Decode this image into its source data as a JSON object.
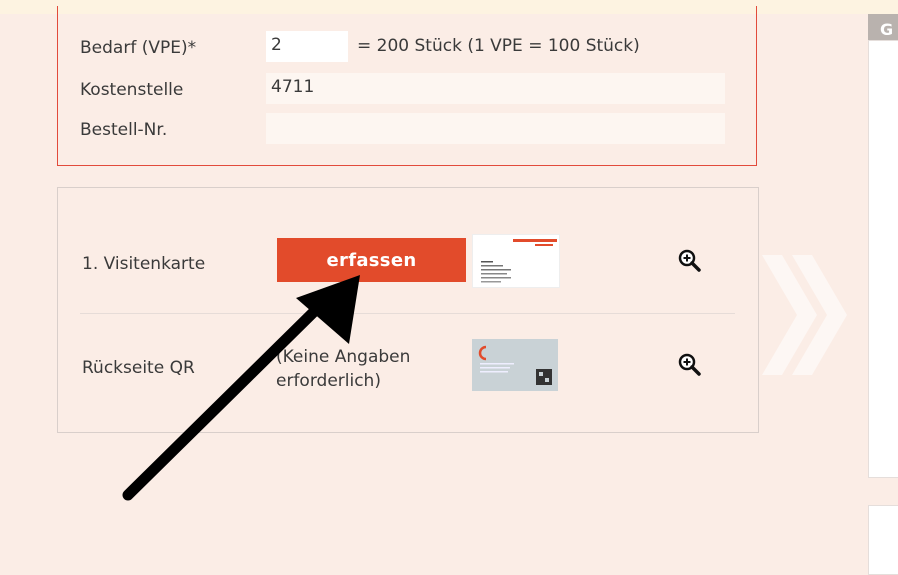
{
  "order": {
    "rows": [
      {
        "label": "Bedarf (VPE)*",
        "value": "2"
      },
      {
        "label": "Kostenstelle",
        "value": "4711"
      },
      {
        "label": "Bestell-Nr.",
        "value": ""
      }
    ],
    "qty_note": "= 200 Stück (1 VPE = 100 Stück)"
  },
  "items": {
    "first": {
      "label": "1. Visitenkarte",
      "button": "erfassen",
      "zoom_icon": "zoom-in-icon"
    },
    "second": {
      "label": "Rückseite QR",
      "note_line1": "(Keine Angaben",
      "note_line2": "erforderlich)",
      "zoom_icon": "zoom-in-icon"
    }
  },
  "right_panel": {
    "header_initial": "G"
  },
  "colors": {
    "accent": "#e24b2b",
    "background": "#fbede6",
    "border_red": "#e24b3b"
  }
}
